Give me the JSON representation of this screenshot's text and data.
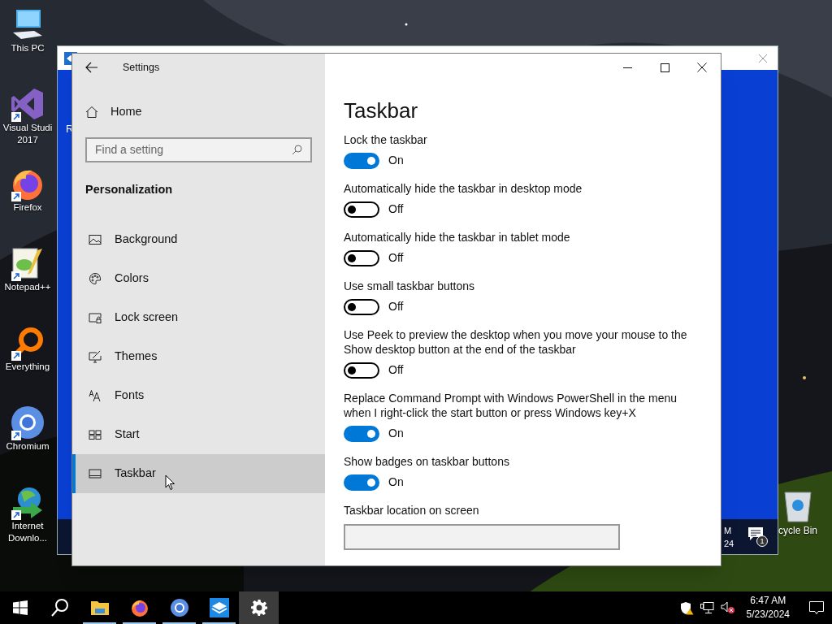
{
  "desktop": {
    "icons": [
      {
        "label": "This PC",
        "kind": "pc"
      },
      {
        "label": "Visual Studi 2017",
        "kind": "vs"
      },
      {
        "label": "Firefox",
        "kind": "firefox"
      },
      {
        "label": "Notepad++",
        "kind": "notepad"
      },
      {
        "label": "Everything",
        "kind": "everything"
      },
      {
        "label": "Chromium",
        "kind": "chromium"
      },
      {
        "label": "Internet Downlo...",
        "kind": "downloader"
      }
    ],
    "recycle_bin": {
      "label": "cycle Bin"
    }
  },
  "back_window": {
    "letter": "R",
    "clock_time": "M",
    "clock_date": "24",
    "notification_count": "1"
  },
  "settings": {
    "title": "Settings",
    "home": "Home",
    "search": {
      "placeholder": "Find a setting"
    },
    "section": "Personalization",
    "nav": [
      {
        "label": "Background",
        "kind": "background",
        "selected": false
      },
      {
        "label": "Colors",
        "kind": "colors",
        "selected": false
      },
      {
        "label": "Lock screen",
        "kind": "lock",
        "selected": false
      },
      {
        "label": "Themes",
        "kind": "themes",
        "selected": false
      },
      {
        "label": "Fonts",
        "kind": "fonts",
        "selected": false
      },
      {
        "label": "Start",
        "kind": "start",
        "selected": false
      },
      {
        "label": "Taskbar",
        "kind": "taskbar",
        "selected": true
      }
    ],
    "page_title": "Taskbar",
    "options": [
      {
        "kind": "toggle",
        "label": "Lock the taskbar",
        "on": true,
        "status": "On"
      },
      {
        "kind": "toggle",
        "label": "Automatically hide the taskbar in desktop mode",
        "on": false,
        "status": "Off"
      },
      {
        "kind": "toggle",
        "label": "Automatically hide the taskbar in tablet mode",
        "on": false,
        "status": "Off"
      },
      {
        "kind": "toggle",
        "label": "Use small taskbar buttons",
        "on": false,
        "status": "Off"
      },
      {
        "kind": "toggle",
        "label": "Use Peek to preview the desktop when you move your mouse to the Show desktop button at the end of the taskbar",
        "on": false,
        "status": "Off"
      },
      {
        "kind": "toggle",
        "label": "Replace Command Prompt with Windows PowerShell in the menu when I right-click the start button or press Windows key+X",
        "on": true,
        "status": "On"
      },
      {
        "kind": "toggle",
        "label": "Show badges on taskbar buttons",
        "on": true,
        "status": "On"
      },
      {
        "kind": "dropdown",
        "label": "Taskbar location on screen"
      }
    ]
  },
  "taskbar": {
    "apps": [
      {
        "kind": "start",
        "running": false,
        "selected": false
      },
      {
        "kind": "search",
        "running": false,
        "selected": false
      },
      {
        "kind": "explorer",
        "running": true,
        "selected": false
      },
      {
        "kind": "firefox",
        "running": true,
        "selected": false
      },
      {
        "kind": "chromium",
        "running": true,
        "selected": false
      },
      {
        "kind": "sandbox",
        "running": true,
        "selected": false
      },
      {
        "kind": "settings",
        "running": false,
        "selected": true
      }
    ],
    "time": "6:47 AM",
    "date": "5/23/2024"
  }
}
